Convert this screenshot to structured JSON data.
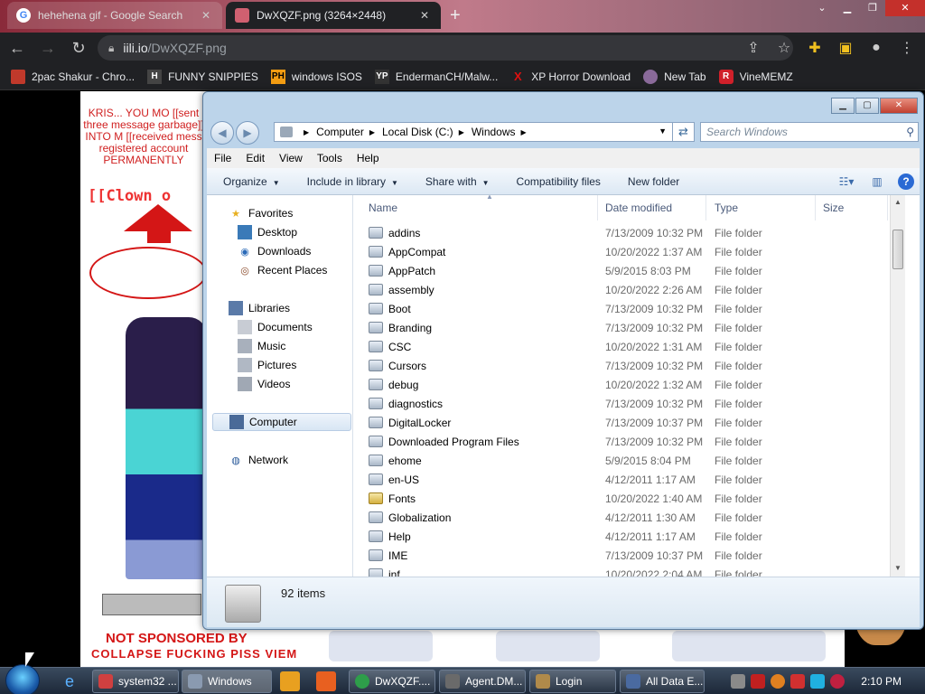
{
  "browser": {
    "tabs": [
      {
        "title": "hehehena gif - Google Search",
        "close": "✕"
      },
      {
        "title": "DwXQZF.png (3264×2448)",
        "close": "✕"
      }
    ],
    "new_tab": "+",
    "url_host": "iili.io",
    "url_path": "/DwXQZF.png",
    "bookmarks": [
      {
        "label": "2pac Shakur - Chro...",
        "icon_text": "",
        "color": "#c0392b"
      },
      {
        "label": "FUNNY SNIPPIES",
        "icon_text": "H",
        "color": "#444444"
      },
      {
        "label": "windows ISOS",
        "icon_text": "PH",
        "color": "#f39c12"
      },
      {
        "label": "EndermanCH/Malw...",
        "icon_text": "YP",
        "color": "#333333"
      },
      {
        "label": "XP Horror Download",
        "icon_text": "X",
        "color": "#e01010"
      },
      {
        "label": "New Tab",
        "icon_text": "",
        "color": "#8a6a9a"
      },
      {
        "label": "VineMEMZ",
        "icon_text": "R",
        "color": "#d0202a"
      }
    ]
  },
  "page_bg": {
    "left_text": "KRIS... YOU MO [[sent three message garbage]] INTO M [[received mess registered account PERMANENTLY",
    "clown_text": "[[Clown o",
    "sponsor": "NOT SPONSORED BY",
    "collapse": "COLLAPSE FUCKING PISS VIEM"
  },
  "explorer": {
    "breadcrumbs": [
      "Computer",
      "Local Disk (C:)",
      "Windows"
    ],
    "search_placeholder": "Search Windows",
    "menu": [
      "File",
      "Edit",
      "View",
      "Tools",
      "Help"
    ],
    "commands": [
      {
        "label": "Organize",
        "has_arrow": true
      },
      {
        "label": "Include in library",
        "has_arrow": true
      },
      {
        "label": "Share with",
        "has_arrow": true
      },
      {
        "label": "Compatibility files",
        "has_arrow": false
      },
      {
        "label": "New folder",
        "has_arrow": false
      }
    ],
    "nav": {
      "favorites": "Favorites",
      "favorites_items": [
        "Desktop",
        "Downloads",
        "Recent Places"
      ],
      "libraries": "Libraries",
      "libraries_items": [
        "Documents",
        "Music",
        "Pictures",
        "Videos"
      ],
      "computer": "Computer",
      "network": "Network"
    },
    "columns": {
      "name": "Name",
      "date": "Date modified",
      "type": "Type",
      "size": "Size"
    },
    "files": [
      {
        "name": "addins",
        "date": "7/13/2009 10:32 PM",
        "type": "File folder"
      },
      {
        "name": "AppCompat",
        "date": "10/20/2022 1:37 AM",
        "type": "File folder"
      },
      {
        "name": "AppPatch",
        "date": "5/9/2015 8:03 PM",
        "type": "File folder"
      },
      {
        "name": "assembly",
        "date": "10/20/2022 2:26 AM",
        "type": "File folder"
      },
      {
        "name": "Boot",
        "date": "7/13/2009 10:32 PM",
        "type": "File folder"
      },
      {
        "name": "Branding",
        "date": "7/13/2009 10:32 PM",
        "type": "File folder"
      },
      {
        "name": "CSC",
        "date": "10/20/2022 1:31 AM",
        "type": "File folder"
      },
      {
        "name": "Cursors",
        "date": "7/13/2009 10:32 PM",
        "type": "File folder"
      },
      {
        "name": "debug",
        "date": "10/20/2022 1:32 AM",
        "type": "File folder"
      },
      {
        "name": "diagnostics",
        "date": "7/13/2009 10:32 PM",
        "type": "File folder"
      },
      {
        "name": "DigitalLocker",
        "date": "7/13/2009 10:37 PM",
        "type": "File folder"
      },
      {
        "name": "Downloaded Program Files",
        "date": "7/13/2009 10:32 PM",
        "type": "File folder"
      },
      {
        "name": "ehome",
        "date": "5/9/2015 8:04 PM",
        "type": "File folder"
      },
      {
        "name": "en-US",
        "date": "4/12/2011 1:17 AM",
        "type": "File folder"
      },
      {
        "name": "Fonts",
        "date": "10/20/2022 1:40 AM",
        "type": "File folder"
      },
      {
        "name": "Globalization",
        "date": "4/12/2011 1:30 AM",
        "type": "File folder"
      },
      {
        "name": "Help",
        "date": "4/12/2011 1:17 AM",
        "type": "File folder"
      },
      {
        "name": "IME",
        "date": "7/13/2009 10:37 PM",
        "type": "File folder"
      },
      {
        "name": "inf",
        "date": "10/20/2022 2:04 AM",
        "type": "File folder"
      }
    ],
    "item_count": "92 items"
  },
  "taskbar": {
    "items": [
      {
        "label": "system32 ...",
        "color": "#d04040"
      },
      {
        "label": "Windows",
        "color": "#8a9ab0"
      },
      {
        "label": "DwXQZF....",
        "color": "#2e9e4a"
      },
      {
        "label": "Agent.DM...",
        "color": "#6a6a6a"
      },
      {
        "label": "Login",
        "color": "#b08a4a"
      },
      {
        "label": "All Data E...",
        "color": "#4a6aa0"
      }
    ],
    "clock": "2:10 PM"
  }
}
